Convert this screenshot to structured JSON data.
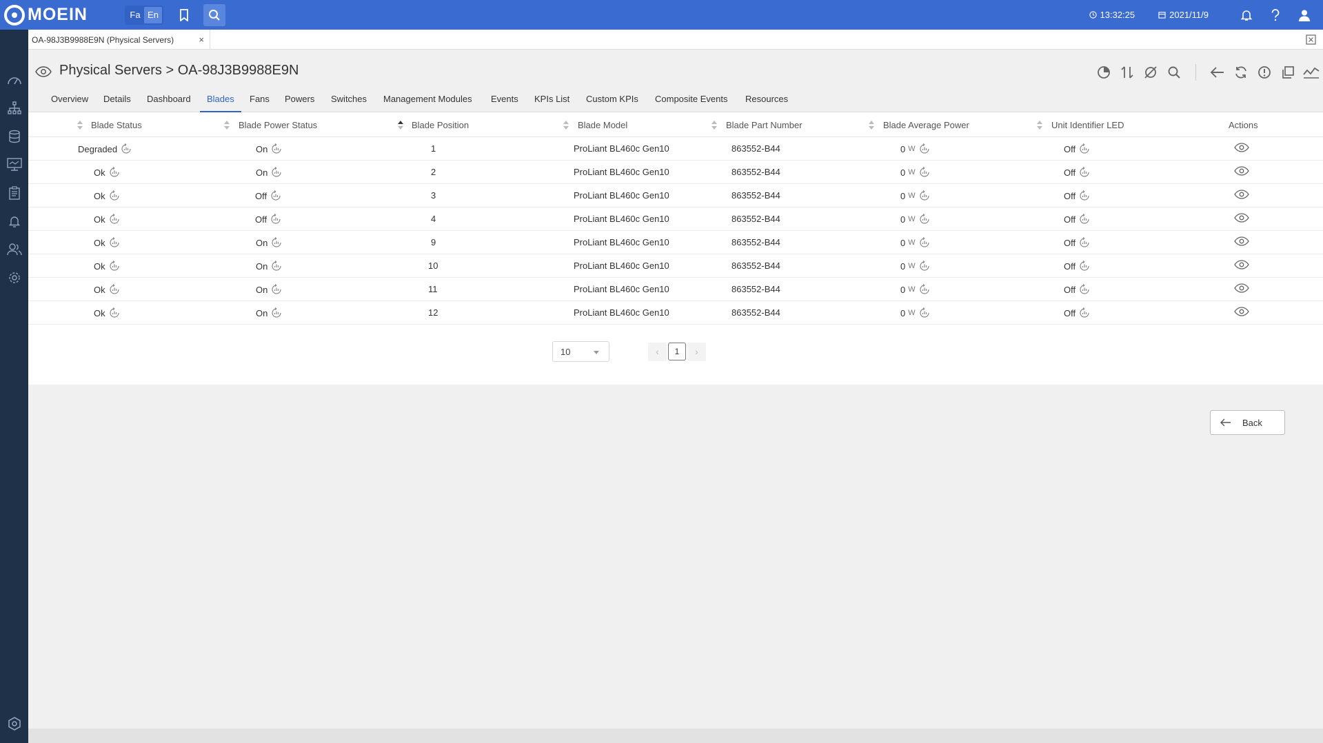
{
  "app": {
    "brand": "MOEIN"
  },
  "topbar": {
    "lang_fa": "Fa",
    "lang_en": "En",
    "time": "13:32:25",
    "date": "2021/11/9"
  },
  "doc_tab": {
    "label": "OA-98J3B9988E9N (Physical Servers)",
    "close": "×"
  },
  "header": {
    "title": "Physical Servers > OA-98J3B9988E9N"
  },
  "subtabs": [
    {
      "label": "Overview"
    },
    {
      "label": "Details"
    },
    {
      "label": "Dashboard"
    },
    {
      "label": "Blades",
      "active": true
    },
    {
      "label": "Fans"
    },
    {
      "label": "Powers"
    },
    {
      "label": "Switches"
    },
    {
      "label": "Management Modules"
    },
    {
      "label": "Events"
    },
    {
      "label": "KPIs List"
    },
    {
      "label": "Custom KPIs"
    },
    {
      "label": "Composite Events"
    },
    {
      "label": "Resources"
    }
  ],
  "table": {
    "columns": [
      "Blade Status",
      "Blade Power Status",
      "Blade Position",
      "Blade Model",
      "Blade Part Number",
      "Blade Average Power",
      "Unit Identifier LED",
      "Actions"
    ],
    "sorted_column": "Blade Position",
    "power_unit": "W",
    "rows": [
      {
        "status": "Degraded",
        "power_status": "On",
        "position": "1",
        "model": "ProLiant BL460c Gen10",
        "part": "863552-B44",
        "avg_power": "0",
        "uid_led": "Off"
      },
      {
        "status": "Ok",
        "power_status": "On",
        "position": "2",
        "model": "ProLiant BL460c Gen10",
        "part": "863552-B44",
        "avg_power": "0",
        "uid_led": "Off"
      },
      {
        "status": "Ok",
        "power_status": "Off",
        "position": "3",
        "model": "ProLiant BL460c Gen10",
        "part": "863552-B44",
        "avg_power": "0",
        "uid_led": "Off"
      },
      {
        "status": "Ok",
        "power_status": "Off",
        "position": "4",
        "model": "ProLiant BL460c Gen10",
        "part": "863552-B44",
        "avg_power": "0",
        "uid_led": "Off"
      },
      {
        "status": "Ok",
        "power_status": "On",
        "position": "9",
        "model": "ProLiant BL460c Gen10",
        "part": "863552-B44",
        "avg_power": "0",
        "uid_led": "Off"
      },
      {
        "status": "Ok",
        "power_status": "On",
        "position": "10",
        "model": "ProLiant BL460c Gen10",
        "part": "863552-B44",
        "avg_power": "0",
        "uid_led": "Off"
      },
      {
        "status": "Ok",
        "power_status": "On",
        "position": "11",
        "model": "ProLiant BL460c Gen10",
        "part": "863552-B44",
        "avg_power": "0",
        "uid_led": "Off"
      },
      {
        "status": "Ok",
        "power_status": "On",
        "position": "12",
        "model": "ProLiant BL460c Gen10",
        "part": "863552-B44",
        "avg_power": "0",
        "uid_led": "Off"
      }
    ]
  },
  "pagination": {
    "page_size": "10",
    "current_page": "1"
  },
  "back_button": {
    "label": "Back"
  },
  "colors": {
    "primary": "#3a6bd1",
    "sidebar": "#1f3149",
    "active_tab": "#2f63c9"
  },
  "icons": {
    "sidebar": [
      "dashboard-icon",
      "topology-icon",
      "database-icon",
      "monitor-icon",
      "clipboard-icon",
      "bell-icon",
      "users-icon",
      "gear-icon"
    ],
    "toolbar": [
      "chart-pie-icon",
      "sort-icon",
      "chart-off-icon",
      "search-icon",
      "arrow-left-icon",
      "refresh-icon",
      "alert-icon",
      "copy-icon",
      "trend-icon"
    ]
  }
}
